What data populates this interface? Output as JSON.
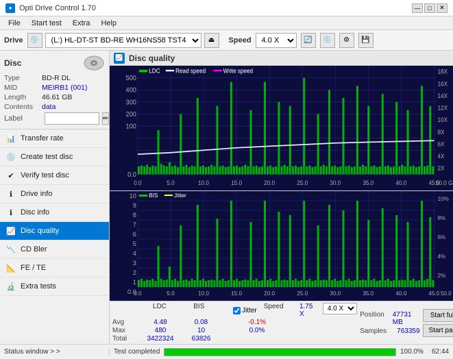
{
  "titlebar": {
    "title": "Opti Drive Control 1.70",
    "icon": "●",
    "controls": [
      "—",
      "□",
      "✕"
    ]
  },
  "menubar": {
    "items": [
      "File",
      "Start test",
      "Extra",
      "Help"
    ]
  },
  "toolbar": {
    "drive_label": "Drive",
    "drive_value": "(L:)  HL-DT-ST BD-RE  WH16NS58 TST4",
    "speed_label": "Speed",
    "speed_value": "4.0 X"
  },
  "sidebar": {
    "disc_section": {
      "header": "Disc",
      "rows": [
        {
          "label": "Type",
          "value": "BD-R DL",
          "color": "black"
        },
        {
          "label": "MID",
          "value": "MEIRB1 (001)",
          "color": "blue"
        },
        {
          "label": "Length",
          "value": "46.61 GB",
          "color": "black"
        },
        {
          "label": "Contents",
          "value": "data",
          "color": "blue"
        },
        {
          "label": "Label",
          "value": "",
          "color": "black"
        }
      ]
    },
    "nav_items": [
      {
        "label": "Transfer rate",
        "active": false
      },
      {
        "label": "Create test disc",
        "active": false
      },
      {
        "label": "Verify test disc",
        "active": false
      },
      {
        "label": "Drive info",
        "active": false
      },
      {
        "label": "Disc info",
        "active": false
      },
      {
        "label": "Disc quality",
        "active": true
      },
      {
        "label": "CD Bler",
        "active": false
      },
      {
        "label": "FE / TE",
        "active": false
      },
      {
        "label": "Extra tests",
        "active": false
      }
    ],
    "status_window": "Status window > >"
  },
  "disc_quality": {
    "title": "Disc quality",
    "charts": {
      "top": {
        "legend": [
          "LDC",
          "Read speed",
          "Write speed"
        ],
        "y_max": 500,
        "y_axis_right": [
          "18X",
          "16X",
          "14X",
          "12X",
          "10X",
          "8X",
          "6X",
          "4X",
          "2X"
        ],
        "x_max": 50,
        "x_label": "GB"
      },
      "bottom": {
        "legend": [
          "BIS",
          "Jitter"
        ],
        "y_max": 10,
        "y_axis_right": [
          "10%",
          "8%",
          "6%",
          "4%",
          "2%"
        ],
        "x_max": 50
      }
    },
    "stats": {
      "headers": [
        "LDC",
        "BIS",
        "",
        "Jitter",
        "Speed",
        ""
      ],
      "avg_label": "Avg",
      "max_label": "Max",
      "total_label": "Total",
      "ldc_avg": "4.48",
      "ldc_max": "480",
      "ldc_total": "3422324",
      "bis_avg": "0.08",
      "bis_max": "10",
      "bis_total": "63826",
      "jitter_avg": "-0.1%",
      "jitter_max": "0.0%",
      "jitter_checked": true,
      "speed_label": "Speed",
      "speed_val": "1.75 X",
      "speed_select": "4.0 X",
      "position_label": "Position",
      "position_val": "47731 MB",
      "samples_label": "Samples",
      "samples_val": "763359"
    },
    "buttons": {
      "start_full": "Start full",
      "start_part": "Start part"
    }
  },
  "statusbar": {
    "status_window": "Status window > >",
    "status_text": "Test completed",
    "progress": 100,
    "progress_text": "100.0%",
    "time": "62:44"
  },
  "colors": {
    "active_nav": "#0078d4",
    "chart_bg": "#1a1a4e",
    "ldc_bar": "#00aa00",
    "bis_bar": "#00cc00",
    "read_speed_line": "#ffffff",
    "jitter_line": "#ffff00",
    "grid_line": "#3333aa",
    "progress_green": "#00cc00"
  }
}
